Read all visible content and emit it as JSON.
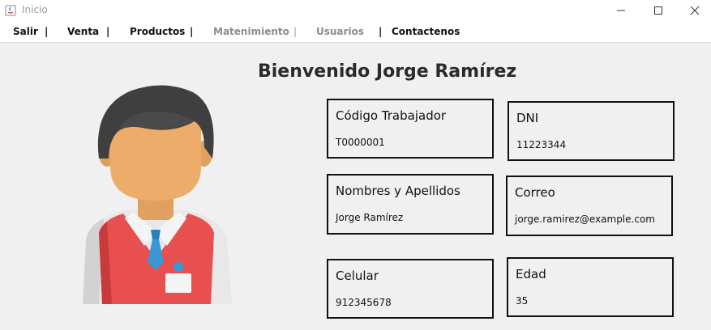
{
  "window": {
    "title": "Inicio"
  },
  "menu": {
    "items": [
      {
        "label": "Salir",
        "enabled": true
      },
      {
        "label": "Venta",
        "enabled": true
      },
      {
        "label": "Productos",
        "enabled": true
      },
      {
        "label": "Matenimiento",
        "enabled": false
      },
      {
        "label": "Usuarios",
        "enabled": false
      },
      {
        "label": "Contactenos",
        "enabled": true
      }
    ],
    "separator": "|"
  },
  "main": {
    "welcome": "Bienvenido Jorge Ramírez",
    "avatar_icon": "worker-avatar-icon"
  },
  "fields": {
    "codigo": {
      "label": "Código Trabajador",
      "value": "T0000001"
    },
    "dni": {
      "label": "DNI",
      "value": "11223344"
    },
    "nombres": {
      "label": "Nombres y Apellidos",
      "value": "Jorge Ramírez"
    },
    "correo": {
      "label": "Correo",
      "value": "jorge.ramirez@example.com"
    },
    "celular": {
      "label": "Celular",
      "value": "912345678"
    },
    "edad": {
      "label": "Edad",
      "value": "35"
    }
  }
}
